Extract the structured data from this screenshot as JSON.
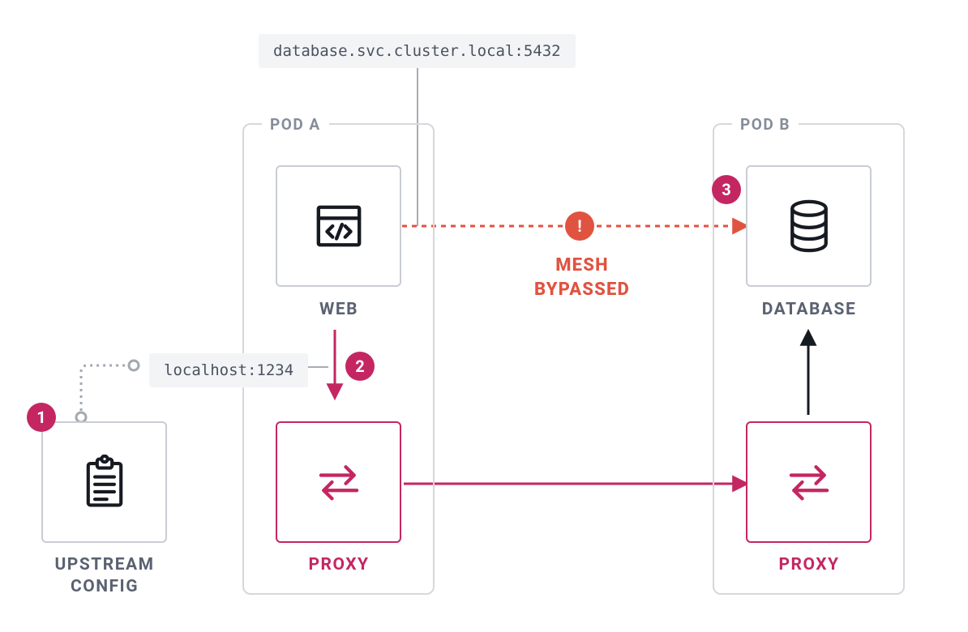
{
  "pods": {
    "a": {
      "label": "POD A"
    },
    "b": {
      "label": "POD B"
    }
  },
  "tiles": {
    "web": {
      "label": "WEB"
    },
    "database": {
      "label": "DATABASE"
    },
    "proxy_a": {
      "label": "PROXY"
    },
    "proxy_b": {
      "label": "PROXY"
    },
    "upstream": {
      "label_line1": "UPSTREAM",
      "label_line2": "CONFIG"
    }
  },
  "addresses": {
    "db": "database.svc.cluster.local:5432",
    "local": "localhost:1234"
  },
  "badges": {
    "one": "1",
    "two": "2",
    "three": "3",
    "alert": "!"
  },
  "bypass": {
    "line1": "MESH",
    "line2": "BYPASSED"
  },
  "colors": {
    "pink": "#c42662",
    "orange": "#e05340",
    "gray": "#868d99",
    "line": "#aeb3bb"
  }
}
